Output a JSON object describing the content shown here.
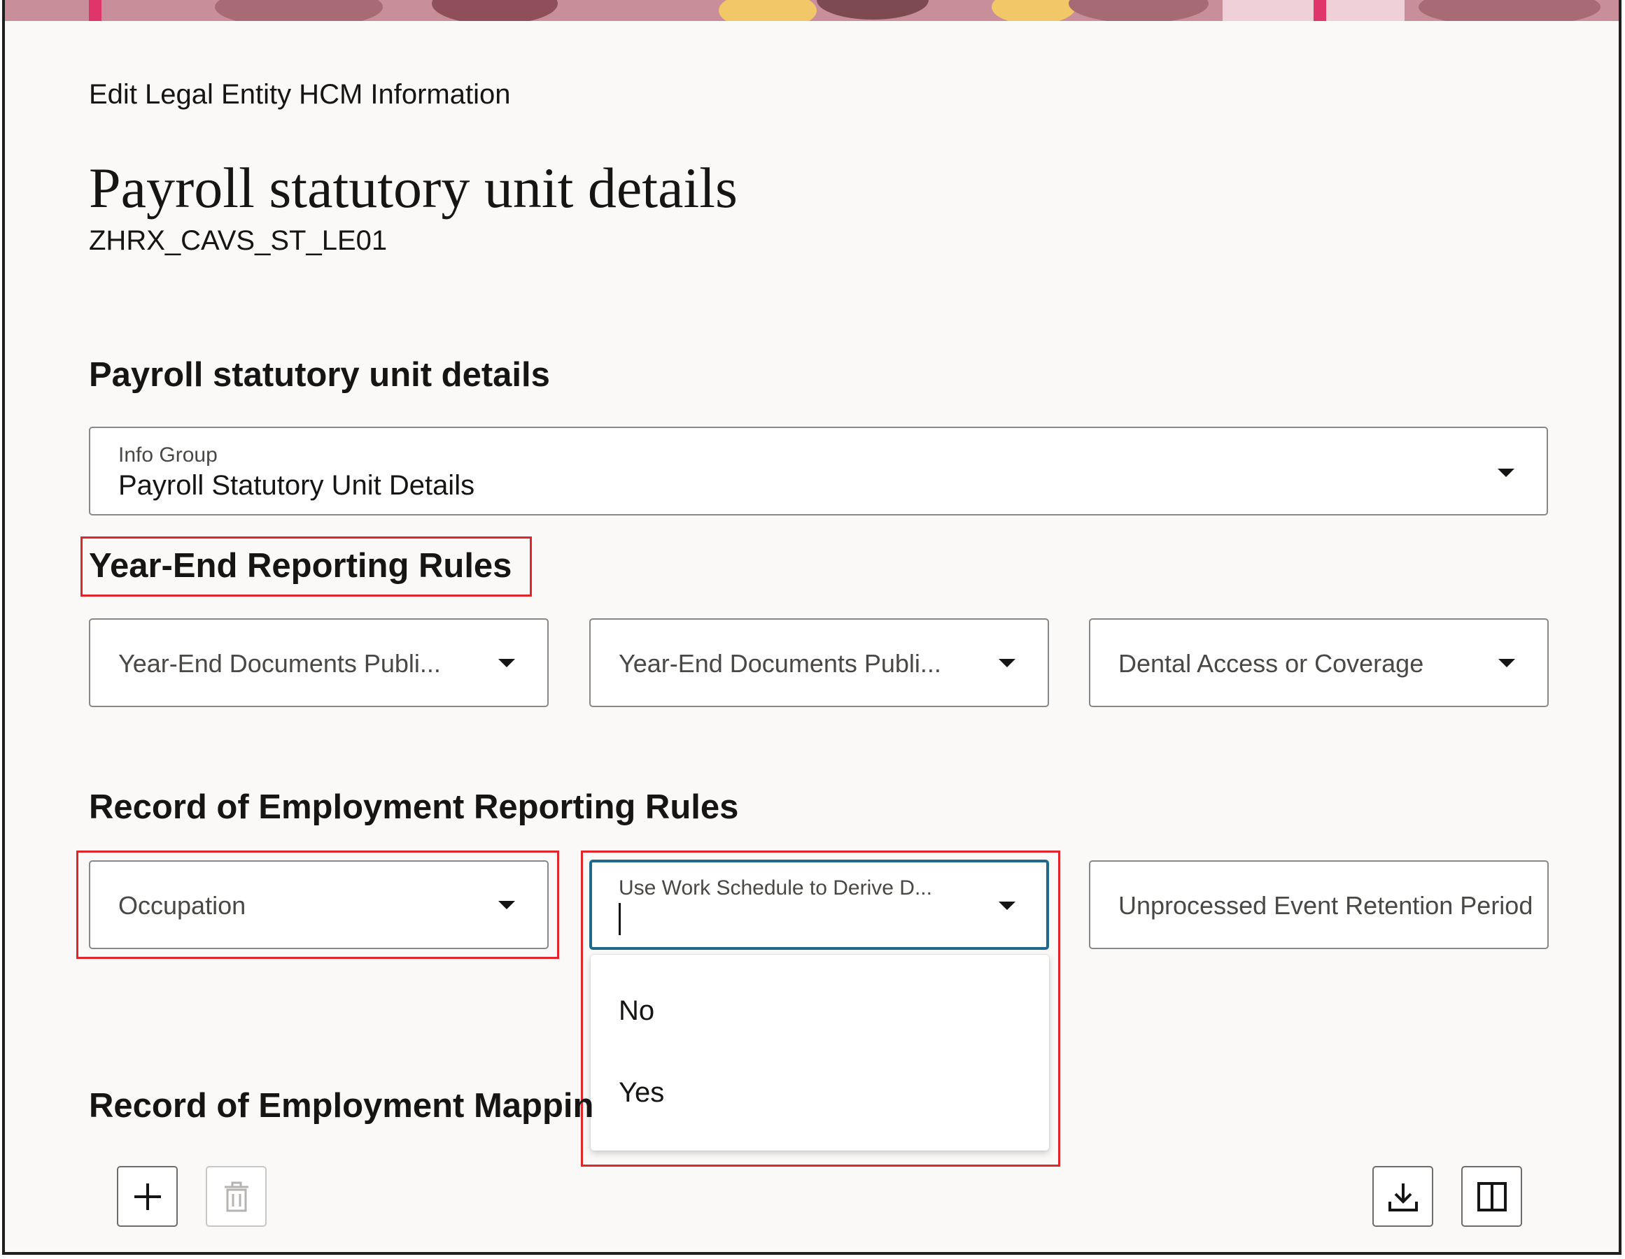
{
  "breadcrumb": "Edit Legal Entity HCM Information",
  "page_title": "Payroll statutory unit details",
  "subtitle": "ZHRX_CAVS_ST_LE01",
  "section_psu": {
    "heading": "Payroll statutory unit details",
    "info_group": {
      "label": "Info Group",
      "value": "Payroll Statutory Unit Details"
    }
  },
  "section_year_end": {
    "heading": "Year-End Reporting Rules",
    "fields": [
      {
        "label": "Year-End Documents Publi..."
      },
      {
        "label": "Year-End Documents Publi..."
      },
      {
        "label": "Dental Access or Coverage"
      }
    ]
  },
  "section_roe": {
    "heading": "Record of Employment Reporting Rules",
    "occupation": {
      "label": "Occupation"
    },
    "work_schedule": {
      "label": "Use Work Schedule to Derive D...",
      "value": ""
    },
    "retention": {
      "label": "Unprocessed Event Retention Period"
    },
    "dropdown_options": [
      "No",
      "Yes"
    ]
  },
  "section_mapping": {
    "heading": "Record of Employment Mappin"
  },
  "toolbar": {
    "add_icon": "plus-icon",
    "delete_icon": "trash-icon",
    "export_icon": "download-icon",
    "columns_icon": "columns-icon"
  },
  "colors": {
    "accent_focus": "#1f6a8c",
    "highlight": "#e0262b",
    "background": "#faf9f8"
  }
}
